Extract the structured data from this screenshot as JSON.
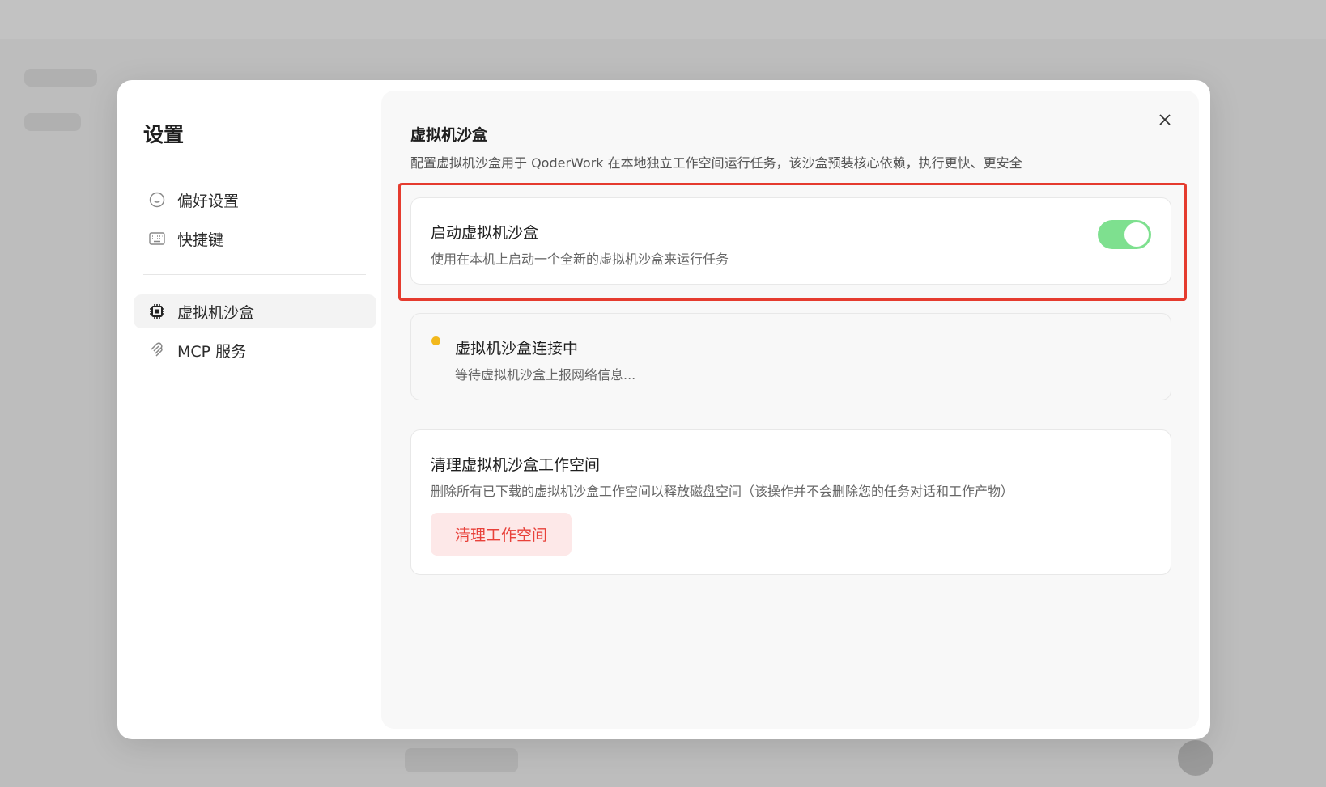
{
  "modal": {
    "title": "设置"
  },
  "nav": {
    "items": [
      {
        "label": "偏好设置",
        "icon": "smile-icon"
      },
      {
        "label": "快捷键",
        "icon": "keyboard-icon"
      },
      {
        "label": "虚拟机沙盒",
        "icon": "chip-icon",
        "active": true
      },
      {
        "label": "MCP 服务",
        "icon": "mcp-icon"
      }
    ]
  },
  "content": {
    "title": "虚拟机沙盒",
    "description": "配置虚拟机沙盒用于 QoderWork 在本地独立工作空间运行任务，该沙盒预装核心依赖，执行更快、更安全",
    "enable_card": {
      "title": "启动虚拟机沙盒",
      "description": "使用在本机上启动一个全新的虚拟机沙盒来运行任务",
      "enabled": true
    },
    "status_card": {
      "title": "虚拟机沙盒连接中",
      "description": "等待虚拟机沙盒上报网络信息...",
      "status_color": "#f2b81c"
    },
    "cleanup_card": {
      "title": "清理虚拟机沙盒工作空间",
      "description": "删除所有已下载的虚拟机沙盒工作空间以释放磁盘空间（该操作并不会删除您的任务对话和工作产物）",
      "button_label": "清理工作空间"
    }
  },
  "colors": {
    "toggle_on": "#7ee08f",
    "danger": "#e8413a",
    "highlight": "#e53b2e"
  }
}
